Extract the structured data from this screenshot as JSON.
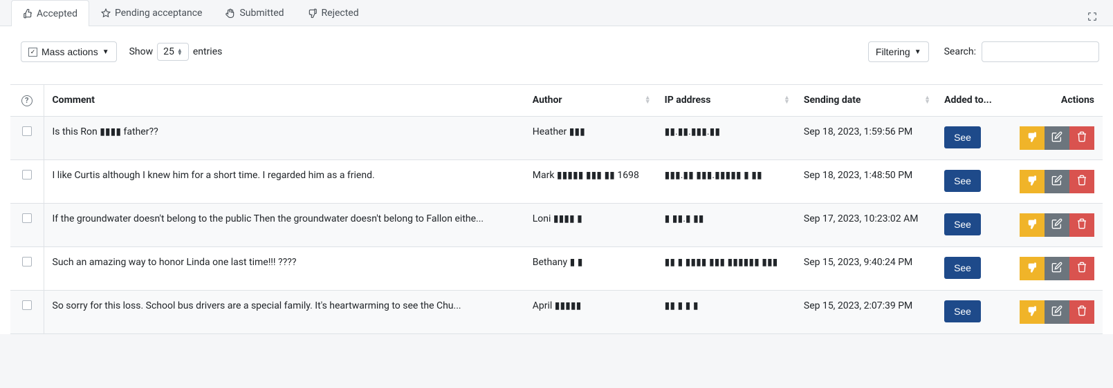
{
  "tabs": [
    {
      "label": "Accepted",
      "icon": "thumbs-up",
      "active": true
    },
    {
      "label": "Pending acceptance",
      "icon": "star",
      "active": false
    },
    {
      "label": "Submitted",
      "icon": "hand",
      "active": false
    },
    {
      "label": "Rejected",
      "icon": "thumbs-down",
      "active": false
    }
  ],
  "toolbar": {
    "mass_actions_label": "Mass actions",
    "show_label": "Show",
    "entries_value": "25",
    "entries_label": "entries",
    "filtering_label": "Filtering",
    "search_label": "Search:",
    "search_value": ""
  },
  "columns": {
    "comment": "Comment",
    "author": "Author",
    "ip": "IP address",
    "sending_date": "Sending date",
    "added_to": "Added to...",
    "actions": "Actions"
  },
  "see_label": "See",
  "rows": [
    {
      "comment": "Is this Ron ▮▮▮▮ father??",
      "author": "Heather ▮▮▮",
      "ip": "▮▮.▮▮.▮▮▮.▮▮",
      "date": "Sep 18, 2023, 1:59:56 PM"
    },
    {
      "comment": "I like Curtis although I knew him for a short time. I regarded him as a friend.",
      "author": "Mark ▮▮▮▮▮ ▮▮▮ ▮▮ 1698",
      "ip": "▮▮▮.▮▮ ▮▮▮.▮▮▮▮▮ ▮ ▮▮",
      "date": "Sep 18, 2023, 1:48:50 PM"
    },
    {
      "comment": "If the groundwater doesn't belong to the public Then the groundwater doesn't belong to Fallon eithe...",
      "author": "Loni ▮▮▮▮ ▮",
      "ip": "▮ ▮▮.▮ ▮▮",
      "date": "Sep 17, 2023, 10:23:02 AM"
    },
    {
      "comment": "Such an amazing way to honor Linda one last time!!! ????",
      "author": "Bethany ▮ ▮",
      "ip": "▮▮ ▮ ▮▮▮▮ ▮▮▮ ▮▮▮▮▮▮ ▮▮▮",
      "date": "Sep 15, 2023, 9:40:24 PM"
    },
    {
      "comment": "So sorry for this loss. School bus drivers are a special family. It's heartwarming to see the Chu...",
      "author": "April ▮▮▮▮▮",
      "ip": "▮▮ ▮ ▮ ▮",
      "date": "Sep 15, 2023, 2:07:39 PM"
    }
  ]
}
